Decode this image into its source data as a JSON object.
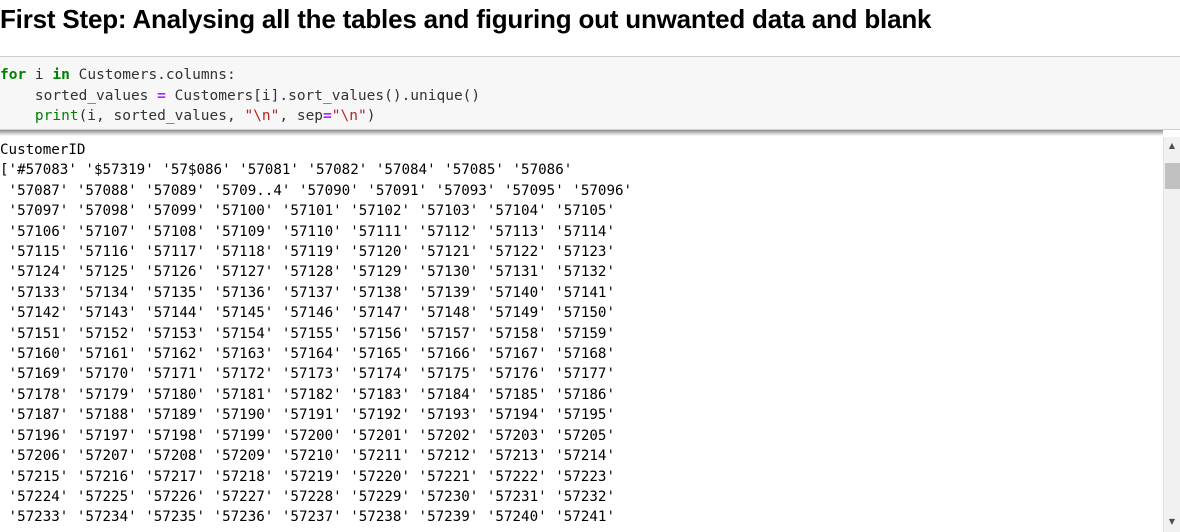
{
  "heading": "First Step: Analysing all the tables and figuring out unwanted data and blank",
  "code_cell": {
    "line1": {
      "kw_for": "for",
      "var_i": " i ",
      "kw_in": "in",
      "rest": " Customers.columns:"
    },
    "line2": {
      "indent_lhs": "    sorted_values ",
      "op_eq": "=",
      "rest": " Customers[i].sort_values().unique()"
    },
    "line3": {
      "indent": "    ",
      "fn_print": "print",
      "args_a": "(i, sorted_values, ",
      "str_newline": "\"\\n\"",
      "comma": ", sep",
      "op_eq": "=",
      "str_sep": "\"\\n\"",
      "close": ")"
    }
  },
  "output": {
    "column_name": "CustomerID",
    "value_lines": [
      "['#57083' '$57319' '57$086' '57081' '57082' '57084' '57085' '57086'",
      " '57087' '57088' '57089' '5709..4' '57090' '57091' '57093' '57095' '57096'",
      " '57097' '57098' '57099' '57100' '57101' '57102' '57103' '57104' '57105'",
      " '57106' '57107' '57108' '57109' '57110' '57111' '57112' '57113' '57114'",
      " '57115' '57116' '57117' '57118' '57119' '57120' '57121' '57122' '57123'",
      " '57124' '57125' '57126' '57127' '57128' '57129' '57130' '57131' '57132'",
      " '57133' '57134' '57135' '57136' '57137' '57138' '57139' '57140' '57141'",
      " '57142' '57143' '57144' '57145' '57146' '57147' '57148' '57149' '57150'",
      " '57151' '57152' '57153' '57154' '57155' '57156' '57157' '57158' '57159'",
      " '57160' '57161' '57162' '57163' '57164' '57165' '57166' '57167' '57168'",
      " '57169' '57170' '57171' '57172' '57173' '57174' '57175' '57176' '57177'",
      " '57178' '57179' '57180' '57181' '57182' '57183' '57184' '57185' '57186'",
      " '57187' '57188' '57189' '57190' '57191' '57192' '57193' '57194' '57195'",
      " '57196' '57197' '57198' '57199' '57200' '57201' '57202' '57203' '57205'",
      " '57206' '57207' '57208' '57209' '57210' '57211' '57212' '57213' '57214'",
      " '57215' '57216' '57217' '57218' '57219' '57220' '57221' '57222' '57223'",
      " '57224' '57225' '57226' '57227' '57228' '57229' '57230' '57231' '57232'",
      " '57233' '57234' '57235' '57236' '57237' '57238' '57239' '57240' '57241'"
    ]
  },
  "scrollbar": {
    "up_icon": "triangle-up-icon",
    "down_icon": "triangle-down-icon",
    "position": 0.02
  }
}
